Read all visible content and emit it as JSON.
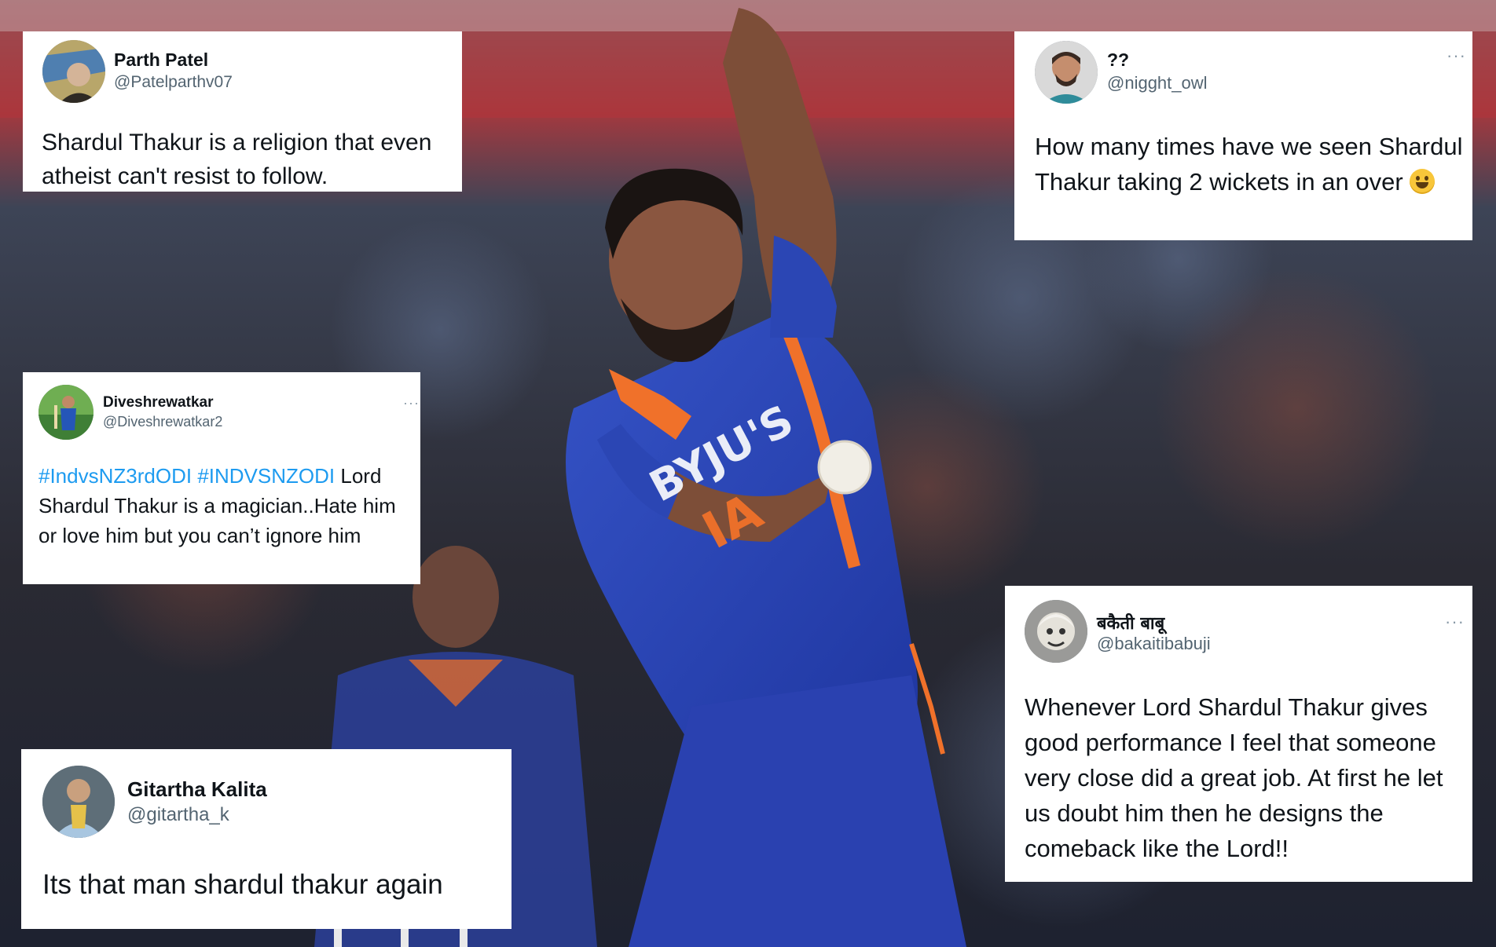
{
  "background": {
    "description_icon": "cricket-bowler-photo",
    "accent_colors": {
      "jersey": "#2946b8",
      "orange": "#f0712a",
      "crowd": "#3a2f34"
    }
  },
  "tweets": [
    {
      "name": "Parth Patel",
      "handle": "@Patelparthv07",
      "avatar_icon": "avatar-icon",
      "text": "Shardul Thakur is a religion that even atheist can't resist to follow."
    },
    {
      "name": "??",
      "handle": "@nigght_owl",
      "avatar_icon": "avatar-icon",
      "more_icon": "more-options-icon",
      "text": "How many times have we seen Shardul Thakur taking 2 wickets in an over",
      "emoji": "grinning-face-emoji"
    },
    {
      "name": "Diveshrewatkar",
      "handle": "@Diveshrewatkar2",
      "avatar_icon": "avatar-icon",
      "more_icon": "more-options-icon",
      "hashtag1": "#IndvsNZ3rdODI",
      "hashtag2": "#INDVSNZODI",
      "text": "Lord Shardul Thakur is a magician..Hate him or love him but you can’t ignore him"
    },
    {
      "name": "बकैती बाबू",
      "handle": "@bakaitibabuji",
      "avatar_icon": "avatar-icon",
      "more_icon": "more-options-icon",
      "text": "Whenever Lord Shardul Thakur gives good performance I feel that someone very close did a great job. At first he let us doubt him then he designs the comeback like the Lord!!"
    },
    {
      "name": "Gitartha Kalita",
      "handle": "@gitartha_k",
      "avatar_icon": "avatar-icon",
      "text": "Its that man shardul thakur again"
    }
  ]
}
